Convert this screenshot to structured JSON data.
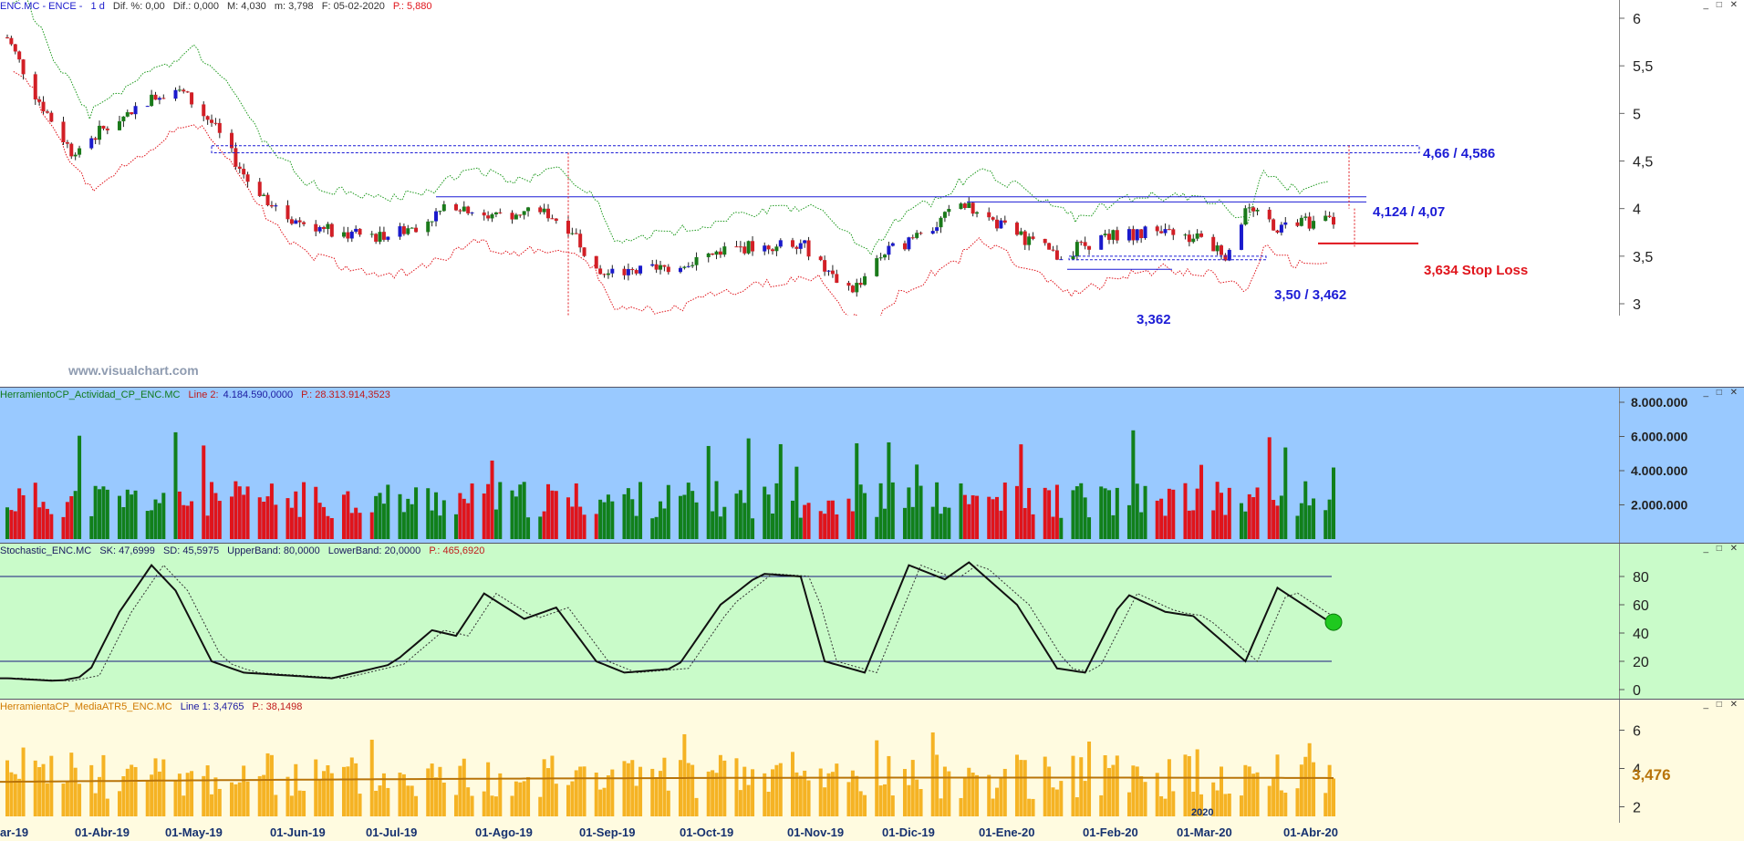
{
  "price_panel": {
    "header": {
      "symbol": "ENC.MC - ENCE -",
      "period": "1 d",
      "dif_pct": "Dif. %: 0,00",
      "dif": "Dif.: 0,000",
      "max": "M: 4,030",
      "min": "m: 3,798",
      "date": "F: 05-02-2020",
      "p": "P.: 5,880"
    },
    "watermark": "www.visualchart.com",
    "y_ticks": [
      "6",
      "5,5",
      "5",
      "4,5",
      "4",
      "3,5",
      "3"
    ],
    "annotations": {
      "resistance": "4,66 / 4,586",
      "level2": "4,124 / 4,07",
      "stop": "3,634 Stop Loss",
      "support": "3,50 / 3,462",
      "low": "3,362"
    },
    "colors": {
      "up": "#1a7a1a",
      "down": "#d21f26",
      "blue": "#1a1acc",
      "annot": "#1c1cd6",
      "stop": "#e0141b"
    }
  },
  "volume_panel": {
    "header": {
      "name": "HerramientoCP_Actividad_CP_ENC.MC",
      "line": "Line 2:",
      "value": "4.184.590,0000",
      "p": "P.: 28.313.914,3523"
    },
    "y_ticks": [
      "8.000.000",
      "6.000.000",
      "4.000.000",
      "2.000.000"
    ],
    "bg": "#99c9ff"
  },
  "stoch_panel": {
    "header": {
      "name": "Stochastic_ENC.MC",
      "sk": "SK: 47,6999",
      "sd": "SD: 45,5975",
      "upper": "UpperBand: 80,0000",
      "lower": "LowerBand: 20,0000",
      "p": "P.: 465,6920"
    },
    "y_ticks": [
      "80",
      "60",
      "40",
      "20",
      "0"
    ],
    "bg": "#c9fbc9"
  },
  "atr_panel": {
    "header": {
      "name": "HerramientaCP_MediaATR5_ENC.MC",
      "line": "Line 1: 3,4765",
      "p": "P.: 38,1498"
    },
    "y_ticks": [
      "6",
      "4",
      "2"
    ],
    "last_value": "3,476",
    "year_label": "2020",
    "bg": "#fffbe0",
    "bar_color": "#f5b324",
    "ma_color": "#b8740a"
  },
  "x_axis": {
    "labels": [
      "ar-19",
      "01-Abr-19",
      "01-May-19",
      "01-Jun-19",
      "01-Jul-19",
      "01-Ago-19",
      "01-Sep-19",
      "01-Oct-19",
      "01-Nov-19",
      "01-Dic-19",
      "01-Ene-20",
      "01-Feb-20",
      "01-Mar-20",
      "01-Abr-20"
    ]
  },
  "chart_data": {
    "type": "candlestick",
    "title": "ENC.MC - ENCE - 1 d",
    "y_range": [
      2.87,
      6.1
    ],
    "x_range": [
      "2019-03-11",
      "2020-04-30"
    ],
    "price_anchors": [
      [
        "2019-03-11",
        5.8
      ],
      [
        "2019-03-18",
        5.2
      ],
      [
        "2019-03-27",
        4.6
      ],
      [
        "2019-04-08",
        4.95
      ],
      [
        "2019-04-22",
        5.3
      ],
      [
        "2019-05-01",
        4.9
      ],
      [
        "2019-05-10",
        4.3
      ],
      [
        "2019-05-20",
        3.9
      ],
      [
        "2019-06-01",
        3.75
      ],
      [
        "2019-06-10",
        3.7
      ],
      [
        "2019-06-20",
        3.8
      ],
      [
        "2019-07-01",
        4.05
      ],
      [
        "2019-07-10",
        3.9
      ],
      [
        "2019-07-22",
        4.0
      ],
      [
        "2019-07-31",
        3.75
      ],
      [
        "2019-08-05",
        3.3
      ],
      [
        "2019-08-20",
        3.35
      ],
      [
        "2019-09-01",
        3.5
      ],
      [
        "2019-09-12",
        3.6
      ],
      [
        "2019-09-25",
        3.65
      ],
      [
        "2019-10-01",
        3.35
      ],
      [
        "2019-10-08",
        3.15
      ],
      [
        "2019-10-15",
        3.5
      ],
      [
        "2019-10-28",
        3.8
      ],
      [
        "2019-11-04",
        4.05
      ],
      [
        "2019-11-15",
        3.8
      ],
      [
        "2019-11-28",
        3.5
      ],
      [
        "2019-12-10",
        3.7
      ],
      [
        "2019-12-20",
        3.75
      ],
      [
        "2020-01-01",
        3.7
      ],
      [
        "2020-01-10",
        3.5
      ],
      [
        "2020-01-14",
        4.0
      ],
      [
        "2020-01-22",
        3.8
      ],
      [
        "2020-02-05",
        3.9
      ]
    ],
    "horizontal_levels": {
      "resistance_zone": [
        4.66,
        4.586
      ],
      "level_4124": 4.124,
      "level_407": 4.07,
      "stop_loss": 3.634,
      "support_zone": [
        3.5,
        3.462
      ],
      "low_3362": 3.362
    },
    "volume_last": 4184590,
    "stochastic": {
      "sk": 47.6999,
      "sd": 45.5975,
      "upper_band": 80,
      "lower_band": 20
    },
    "stoch_anchors": [
      [
        "2019-03-11",
        8
      ],
      [
        "2019-03-24",
        6
      ],
      [
        "2019-03-31",
        10
      ],
      [
        "2019-04-08",
        55
      ],
      [
        "2019-04-16",
        88
      ],
      [
        "2019-04-22",
        70
      ],
      [
        "2019-05-01",
        20
      ],
      [
        "2019-05-09",
        12
      ],
      [
        "2019-05-31",
        8
      ],
      [
        "2019-06-15",
        18
      ],
      [
        "2019-06-25",
        42
      ],
      [
        "2019-07-01",
        38
      ],
      [
        "2019-07-08",
        68
      ],
      [
        "2019-07-18",
        50
      ],
      [
        "2019-07-26",
        58
      ],
      [
        "2019-08-05",
        20
      ],
      [
        "2019-08-12",
        12
      ],
      [
        "2019-08-25",
        15
      ],
      [
        "2019-09-05",
        60
      ],
      [
        "2019-09-15",
        82
      ],
      [
        "2019-09-25",
        80
      ],
      [
        "2019-10-01",
        20
      ],
      [
        "2019-10-11",
        12
      ],
      [
        "2019-10-22",
        88
      ],
      [
        "2019-10-31",
        78
      ],
      [
        "2019-11-06",
        90
      ],
      [
        "2019-11-18",
        60
      ],
      [
        "2019-11-28",
        15
      ],
      [
        "2019-12-05",
        12
      ],
      [
        "2019-12-15",
        68
      ],
      [
        "2019-12-25",
        55
      ],
      [
        "2020-01-01",
        52
      ],
      [
        "2020-01-14",
        20
      ],
      [
        "2020-01-22",
        72
      ],
      [
        "2020-02-05",
        46
      ]
    ],
    "atr_last": 3.4765,
    "atr_ma_range": [
      3.3,
      3.9
    ]
  }
}
